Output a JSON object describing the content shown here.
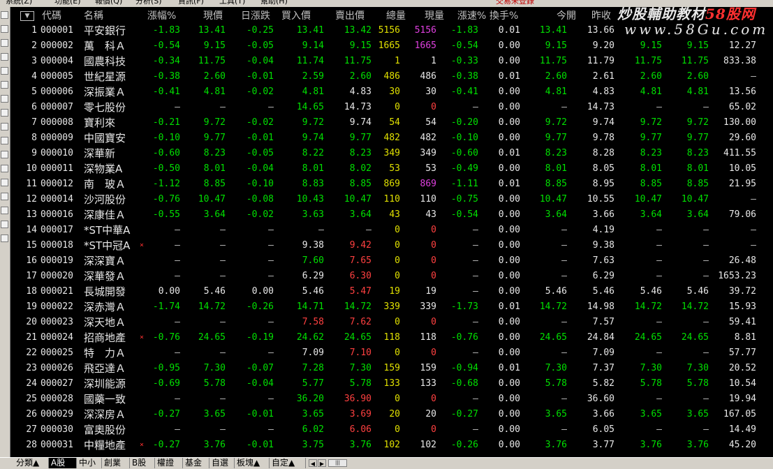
{
  "menubar": [
    "系統(Z)",
    "功能(E)",
    "報價(Q)",
    "分析(S)",
    "資訊(F)",
    "工具(T)",
    "幫助(H)",
    "交易未登錄"
  ],
  "watermark": {
    "line1_pre": "炒股輔助教材",
    "line1_red": "58股网",
    "line2": "www.58Gu.com"
  },
  "sort_indicator": "▼",
  "columns": [
    "",
    "代碼",
    "名稱",
    "漲幅%",
    "現價",
    "日漲跌",
    "買入價",
    "賣出價",
    "總量",
    "現量",
    "漲速%",
    "換手%",
    "今開",
    "昨收",
    "",
    "",
    ""
  ],
  "rows": [
    {
      "i": "1",
      "code": "000001",
      "name": "平安銀行",
      "flag": "",
      "v": [
        "-1.83",
        "13.41",
        "-0.25",
        "13.41",
        "13.42",
        "5156",
        "5156",
        "-1.83",
        "0.01",
        "13.41",
        "13.66",
        "",
        ""
      ],
      "c": [
        "g",
        "g",
        "g",
        "g",
        "g",
        "y",
        "m",
        "g",
        "w",
        "g",
        "w",
        "",
        ""
      ]
    },
    {
      "i": "2",
      "code": "000002",
      "name": "萬　科Ａ",
      "flag": "",
      "v": [
        "-0.54",
        "9.15",
        "-0.05",
        "9.14",
        "9.15",
        "1665",
        "1665",
        "-0.54",
        "0.00",
        "9.15",
        "9.20",
        "9.15",
        "9.15",
        "12.27"
      ],
      "c": [
        "g",
        "g",
        "g",
        "g",
        "g",
        "y",
        "m",
        "g",
        "w",
        "g",
        "w",
        "g",
        "g",
        "w"
      ]
    },
    {
      "i": "3",
      "code": "000004",
      "name": "國農科技",
      "flag": "",
      "v": [
        "-0.34",
        "11.75",
        "-0.04",
        "11.74",
        "11.75",
        "1",
        "1",
        "-0.33",
        "0.00",
        "11.75",
        "11.79",
        "11.75",
        "11.75",
        "833.38"
      ],
      "c": [
        "g",
        "g",
        "g",
        "g",
        "g",
        "y",
        "w",
        "g",
        "w",
        "g",
        "w",
        "g",
        "g",
        "w"
      ]
    },
    {
      "i": "4",
      "code": "000005",
      "name": "世紀星源",
      "flag": "",
      "v": [
        "-0.38",
        "2.60",
        "-0.01",
        "2.59",
        "2.60",
        "486",
        "486",
        "-0.38",
        "0.01",
        "2.60",
        "2.61",
        "2.60",
        "2.60",
        "—"
      ],
      "c": [
        "g",
        "g",
        "g",
        "g",
        "g",
        "y",
        "w",
        "g",
        "w",
        "g",
        "w",
        "g",
        "g",
        "w"
      ]
    },
    {
      "i": "5",
      "code": "000006",
      "name": "深振業Ａ",
      "flag": "",
      "v": [
        "-0.41",
        "4.81",
        "-0.02",
        "4.81",
        "4.83",
        "30",
        "30",
        "-0.41",
        "0.00",
        "4.81",
        "4.83",
        "4.81",
        "4.81",
        "13.56"
      ],
      "c": [
        "g",
        "g",
        "g",
        "g",
        "w",
        "y",
        "w",
        "g",
        "w",
        "g",
        "w",
        "g",
        "g",
        "w"
      ]
    },
    {
      "i": "6",
      "code": "000007",
      "name": "零七股份",
      "flag": "",
      "v": [
        "—",
        "—",
        "—",
        "14.65",
        "14.73",
        "0",
        "0",
        "—",
        "0.00",
        "—",
        "14.73",
        "—",
        "—",
        "65.02"
      ],
      "c": [
        "w",
        "w",
        "w",
        "g",
        "w",
        "y",
        "rd",
        "w",
        "w",
        "w",
        "w",
        "w",
        "w",
        "w"
      ]
    },
    {
      "i": "7",
      "code": "000008",
      "name": "寶利來",
      "flag": "",
      "v": [
        "-0.21",
        "9.72",
        "-0.02",
        "9.72",
        "9.74",
        "54",
        "54",
        "-0.20",
        "0.00",
        "9.72",
        "9.74",
        "9.72",
        "9.72",
        "130.00"
      ],
      "c": [
        "g",
        "g",
        "g",
        "g",
        "w",
        "y",
        "w",
        "g",
        "w",
        "g",
        "w",
        "g",
        "g",
        "w"
      ]
    },
    {
      "i": "8",
      "code": "000009",
      "name": "中國寶安",
      "flag": "",
      "v": [
        "-0.10",
        "9.77",
        "-0.01",
        "9.74",
        "9.77",
        "482",
        "482",
        "-0.10",
        "0.00",
        "9.77",
        "9.78",
        "9.77",
        "9.77",
        "29.60"
      ],
      "c": [
        "g",
        "g",
        "g",
        "g",
        "g",
        "y",
        "w",
        "g",
        "w",
        "g",
        "w",
        "g",
        "g",
        "w"
      ]
    },
    {
      "i": "9",
      "code": "000010",
      "name": "深華新",
      "flag": "",
      "v": [
        "-0.60",
        "8.23",
        "-0.05",
        "8.22",
        "8.23",
        "349",
        "349",
        "-0.60",
        "0.01",
        "8.23",
        "8.28",
        "8.23",
        "8.23",
        "411.55"
      ],
      "c": [
        "g",
        "g",
        "g",
        "g",
        "g",
        "y",
        "w",
        "g",
        "w",
        "g",
        "w",
        "g",
        "g",
        "w"
      ]
    },
    {
      "i": "10",
      "code": "000011",
      "name": "深物業A",
      "flag": "",
      "v": [
        "-0.50",
        "8.01",
        "-0.04",
        "8.01",
        "8.02",
        "53",
        "53",
        "-0.49",
        "0.00",
        "8.01",
        "8.05",
        "8.01",
        "8.01",
        "10.05"
      ],
      "c": [
        "g",
        "g",
        "g",
        "g",
        "g",
        "y",
        "w",
        "g",
        "w",
        "g",
        "w",
        "g",
        "g",
        "w"
      ]
    },
    {
      "i": "11",
      "code": "000012",
      "name": "南　玻Ａ",
      "flag": "",
      "v": [
        "-1.12",
        "8.85",
        "-0.10",
        "8.83",
        "8.85",
        "869",
        "869",
        "-1.11",
        "0.01",
        "8.85",
        "8.95",
        "8.85",
        "8.85",
        "21.95"
      ],
      "c": [
        "g",
        "g",
        "g",
        "g",
        "g",
        "y",
        "m",
        "g",
        "w",
        "g",
        "w",
        "g",
        "g",
        "w"
      ]
    },
    {
      "i": "12",
      "code": "000014",
      "name": "沙河股份",
      "flag": "",
      "v": [
        "-0.76",
        "10.47",
        "-0.08",
        "10.43",
        "10.47",
        "110",
        "110",
        "-0.75",
        "0.00",
        "10.47",
        "10.55",
        "10.47",
        "10.47",
        "—"
      ],
      "c": [
        "g",
        "g",
        "g",
        "g",
        "g",
        "y",
        "w",
        "g",
        "w",
        "g",
        "w",
        "g",
        "g",
        "w"
      ]
    },
    {
      "i": "13",
      "code": "000016",
      "name": "深康佳Ａ",
      "flag": "",
      "v": [
        "-0.55",
        "3.64",
        "-0.02",
        "3.63",
        "3.64",
        "43",
        "43",
        "-0.54",
        "0.00",
        "3.64",
        "3.66",
        "3.64",
        "3.64",
        "79.06"
      ],
      "c": [
        "g",
        "g",
        "g",
        "g",
        "g",
        "y",
        "w",
        "g",
        "w",
        "g",
        "w",
        "g",
        "g",
        "w"
      ]
    },
    {
      "i": "14",
      "code": "000017",
      "name": "*ST中華A",
      "flag": "",
      "v": [
        "—",
        "—",
        "—",
        "—",
        "—",
        "0",
        "0",
        "—",
        "0.00",
        "—",
        "4.19",
        "—",
        "—",
        "—"
      ],
      "c": [
        "w",
        "w",
        "w",
        "w",
        "w",
        "y",
        "rd",
        "w",
        "w",
        "w",
        "w",
        "w",
        "w",
        "w"
      ]
    },
    {
      "i": "15",
      "code": "000018",
      "name": "*ST中冠A",
      "flag": "×",
      "v": [
        "—",
        "—",
        "—",
        "9.38",
        "9.42",
        "0",
        "0",
        "—",
        "0.00",
        "—",
        "9.38",
        "—",
        "—",
        "—"
      ],
      "c": [
        "w",
        "w",
        "w",
        "w",
        "rd",
        "y",
        "rd",
        "w",
        "w",
        "w",
        "w",
        "w",
        "w",
        "w"
      ]
    },
    {
      "i": "16",
      "code": "000019",
      "name": "深深寶Ａ",
      "flag": "",
      "v": [
        "—",
        "—",
        "—",
        "7.60",
        "7.65",
        "0",
        "0",
        "—",
        "0.00",
        "—",
        "7.63",
        "—",
        "—",
        "26.48"
      ],
      "c": [
        "w",
        "w",
        "w",
        "g",
        "rd",
        "y",
        "rd",
        "w",
        "w",
        "w",
        "w",
        "w",
        "w",
        "w"
      ]
    },
    {
      "i": "17",
      "code": "000020",
      "name": "深華發Ａ",
      "flag": "",
      "v": [
        "—",
        "—",
        "—",
        "6.29",
        "6.30",
        "0",
        "0",
        "—",
        "0.00",
        "—",
        "6.29",
        "—",
        "—",
        "1653.23"
      ],
      "c": [
        "w",
        "w",
        "w",
        "w",
        "rd",
        "y",
        "rd",
        "w",
        "w",
        "w",
        "w",
        "w",
        "w",
        "w"
      ]
    },
    {
      "i": "18",
      "code": "000021",
      "name": "長城開發",
      "flag": "",
      "v": [
        "0.00",
        "5.46",
        "0.00",
        "5.46",
        "5.47",
        "19",
        "19",
        "—",
        "0.00",
        "5.46",
        "5.46",
        "5.46",
        "5.46",
        "39.72"
      ],
      "c": [
        "w",
        "w",
        "w",
        "w",
        "rd",
        "y",
        "w",
        "w",
        "w",
        "w",
        "w",
        "w",
        "w",
        "w"
      ]
    },
    {
      "i": "19",
      "code": "000022",
      "name": "深赤灣Ａ",
      "flag": "",
      "v": [
        "-1.74",
        "14.72",
        "-0.26",
        "14.71",
        "14.72",
        "339",
        "339",
        "-1.73",
        "0.01",
        "14.72",
        "14.98",
        "14.72",
        "14.72",
        "15.93"
      ],
      "c": [
        "g",
        "g",
        "g",
        "g",
        "g",
        "y",
        "w",
        "g",
        "w",
        "g",
        "w",
        "g",
        "g",
        "w"
      ]
    },
    {
      "i": "20",
      "code": "000023",
      "name": "深天地Ａ",
      "flag": "",
      "v": [
        "—",
        "—",
        "—",
        "7.58",
        "7.62",
        "0",
        "0",
        "—",
        "0.00",
        "—",
        "7.57",
        "—",
        "—",
        "59.41"
      ],
      "c": [
        "w",
        "w",
        "w",
        "rd",
        "rd",
        "y",
        "rd",
        "w",
        "w",
        "w",
        "w",
        "w",
        "w",
        "w"
      ]
    },
    {
      "i": "21",
      "code": "000024",
      "name": "招商地產",
      "flag": "×",
      "v": [
        "-0.76",
        "24.65",
        "-0.19",
        "24.62",
        "24.65",
        "118",
        "118",
        "-0.76",
        "0.00",
        "24.65",
        "24.84",
        "24.65",
        "24.65",
        "8.81"
      ],
      "c": [
        "g",
        "g",
        "g",
        "g",
        "g",
        "y",
        "w",
        "g",
        "w",
        "g",
        "w",
        "g",
        "g",
        "w"
      ]
    },
    {
      "i": "22",
      "code": "000025",
      "name": "特　力Ａ",
      "flag": "",
      "v": [
        "—",
        "—",
        "—",
        "7.09",
        "7.10",
        "0",
        "0",
        "—",
        "0.00",
        "—",
        "7.09",
        "—",
        "—",
        "57.77"
      ],
      "c": [
        "w",
        "w",
        "w",
        "w",
        "rd",
        "y",
        "rd",
        "w",
        "w",
        "w",
        "w",
        "w",
        "w",
        "w"
      ]
    },
    {
      "i": "23",
      "code": "000026",
      "name": "飛亞達Ａ",
      "flag": "",
      "v": [
        "-0.95",
        "7.30",
        "-0.07",
        "7.28",
        "7.30",
        "159",
        "159",
        "-0.94",
        "0.01",
        "7.30",
        "7.37",
        "7.30",
        "7.30",
        "20.52"
      ],
      "c": [
        "g",
        "g",
        "g",
        "g",
        "g",
        "y",
        "w",
        "g",
        "w",
        "g",
        "w",
        "g",
        "g",
        "w"
      ]
    },
    {
      "i": "24",
      "code": "000027",
      "name": "深圳能源",
      "flag": "",
      "v": [
        "-0.69",
        "5.78",
        "-0.04",
        "5.77",
        "5.78",
        "133",
        "133",
        "-0.68",
        "0.00",
        "5.78",
        "5.82",
        "5.78",
        "5.78",
        "10.54"
      ],
      "c": [
        "g",
        "g",
        "g",
        "g",
        "g",
        "y",
        "w",
        "g",
        "w",
        "g",
        "w",
        "g",
        "g",
        "w"
      ]
    },
    {
      "i": "25",
      "code": "000028",
      "name": "國藥一致",
      "flag": "",
      "v": [
        "—",
        "—",
        "—",
        "36.20",
        "36.90",
        "0",
        "0",
        "—",
        "0.00",
        "—",
        "36.60",
        "—",
        "—",
        "19.94"
      ],
      "c": [
        "w",
        "w",
        "w",
        "g",
        "rd",
        "y",
        "rd",
        "w",
        "w",
        "w",
        "w",
        "w",
        "w",
        "w"
      ]
    },
    {
      "i": "26",
      "code": "000029",
      "name": "深深房Ａ",
      "flag": "",
      "v": [
        "-0.27",
        "3.65",
        "-0.01",
        "3.65",
        "3.69",
        "20",
        "20",
        "-0.27",
        "0.00",
        "3.65",
        "3.66",
        "3.65",
        "3.65",
        "167.05"
      ],
      "c": [
        "g",
        "g",
        "g",
        "g",
        "rd",
        "y",
        "w",
        "g",
        "w",
        "g",
        "w",
        "g",
        "g",
        "w"
      ]
    },
    {
      "i": "27",
      "code": "000030",
      "name": "富奧股份",
      "flag": "",
      "v": [
        "—",
        "—",
        "—",
        "6.02",
        "6.06",
        "0",
        "0",
        "—",
        "0.00",
        "—",
        "6.05",
        "—",
        "—",
        "14.49"
      ],
      "c": [
        "w",
        "w",
        "w",
        "g",
        "rd",
        "y",
        "rd",
        "w",
        "w",
        "w",
        "w",
        "w",
        "w",
        "w"
      ]
    },
    {
      "i": "28",
      "code": "000031",
      "name": "中糧地產",
      "flag": "×",
      "v": [
        "-0.27",
        "3.76",
        "-0.01",
        "3.75",
        "3.76",
        "102",
        "102",
        "-0.26",
        "0.00",
        "3.76",
        "3.77",
        "3.76",
        "3.76",
        "45.20"
      ],
      "c": [
        "g",
        "g",
        "g",
        "g",
        "g",
        "y",
        "w",
        "g",
        "w",
        "g",
        "w",
        "g",
        "g",
        "w"
      ]
    }
  ],
  "tabs": [
    "分類▲",
    "A股",
    "中小",
    "創業",
    "B股",
    "權證",
    "基金",
    "自選",
    "板塊▲",
    "自定▲"
  ],
  "active_tab": 1,
  "colors": {
    "up": "#ff4040",
    "down": "#00e000",
    "volume": "#e0e000",
    "bigvol": "#e040e0",
    "neutral": "#e8e8e8"
  }
}
